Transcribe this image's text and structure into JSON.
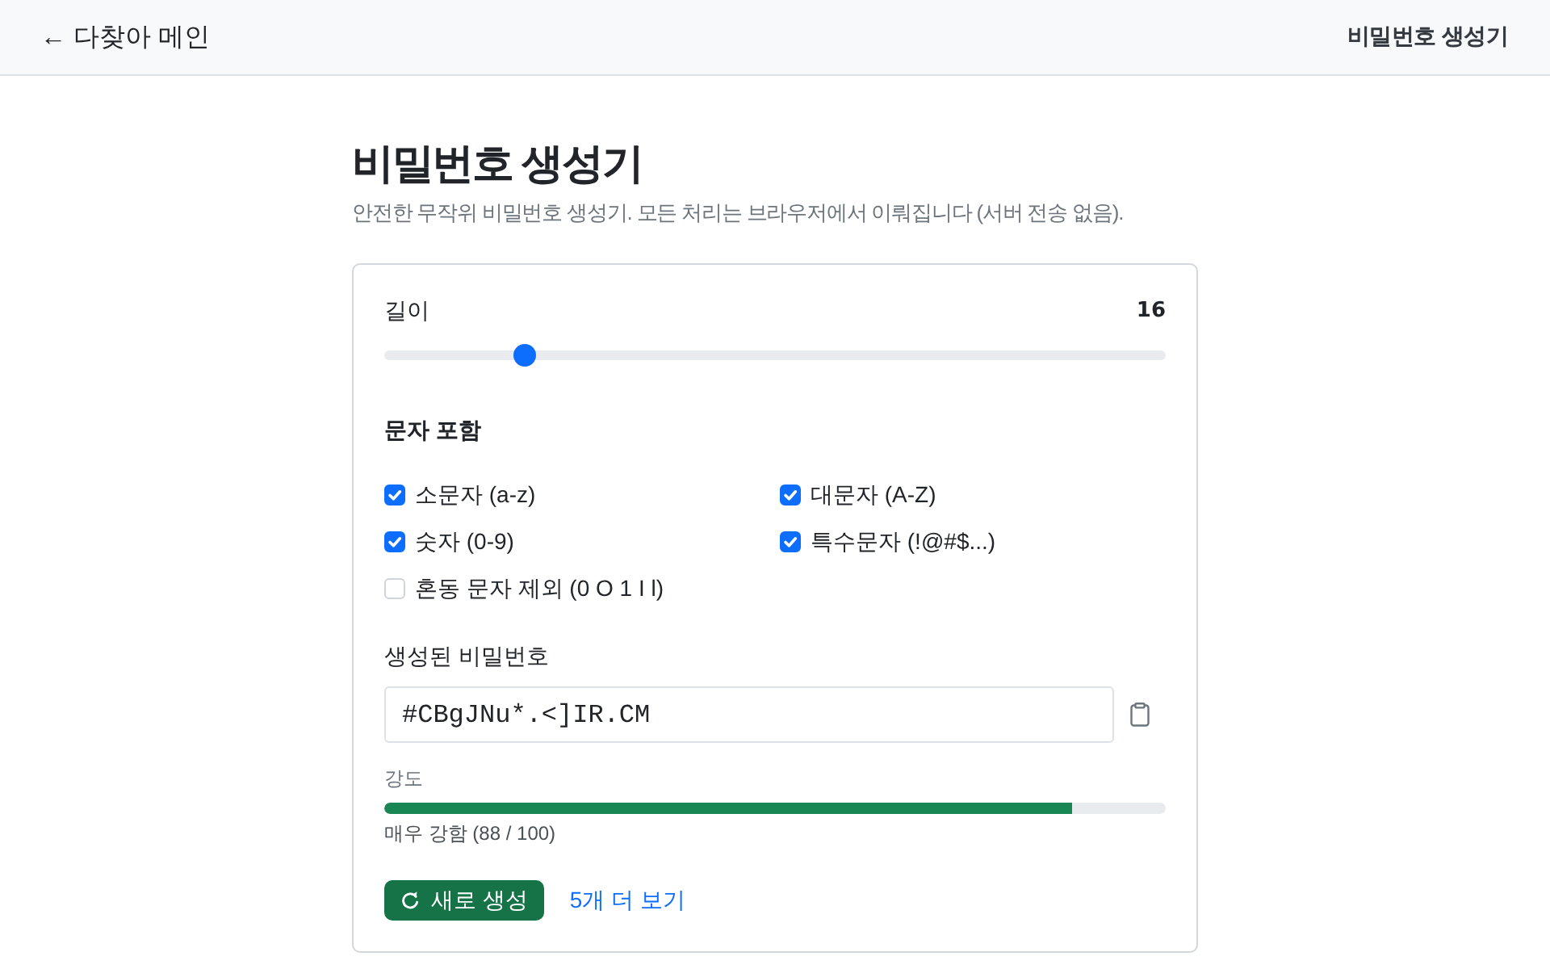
{
  "header": {
    "back_link": "← 다찾아 메인",
    "page_name": "비밀번호 생성기"
  },
  "title": "비밀번호 생성기",
  "subtitle": "안전한 무작위 비밀번호 생성기. 모든 처리는 브라우저에서 이뤄집니다 (서버 전송 없음).",
  "length": {
    "label": "길이",
    "value": "16",
    "level": 0.18
  },
  "charset": {
    "heading": "문자 포함",
    "options": [
      {
        "label": "소문자 (a-z)",
        "checked": true
      },
      {
        "label": "대문자 (A-Z)",
        "checked": true
      },
      {
        "label": "숫자 (0-9)",
        "checked": true
      },
      {
        "label": "특수문자 (!@#$...)",
        "checked": true
      },
      {
        "label": "혼동 문자 제외 (0 O 1 I l)",
        "checked": false
      }
    ]
  },
  "output": {
    "label": "생성된 비밀번호",
    "value": "#CBgJNu*.<]IR.CM"
  },
  "strength": {
    "label": "강도",
    "level": 0.88,
    "reading": "매우 강함 (88 / 100)"
  },
  "actions": {
    "regenerate": "새로 생성",
    "more_link": "5개 더 보기"
  }
}
